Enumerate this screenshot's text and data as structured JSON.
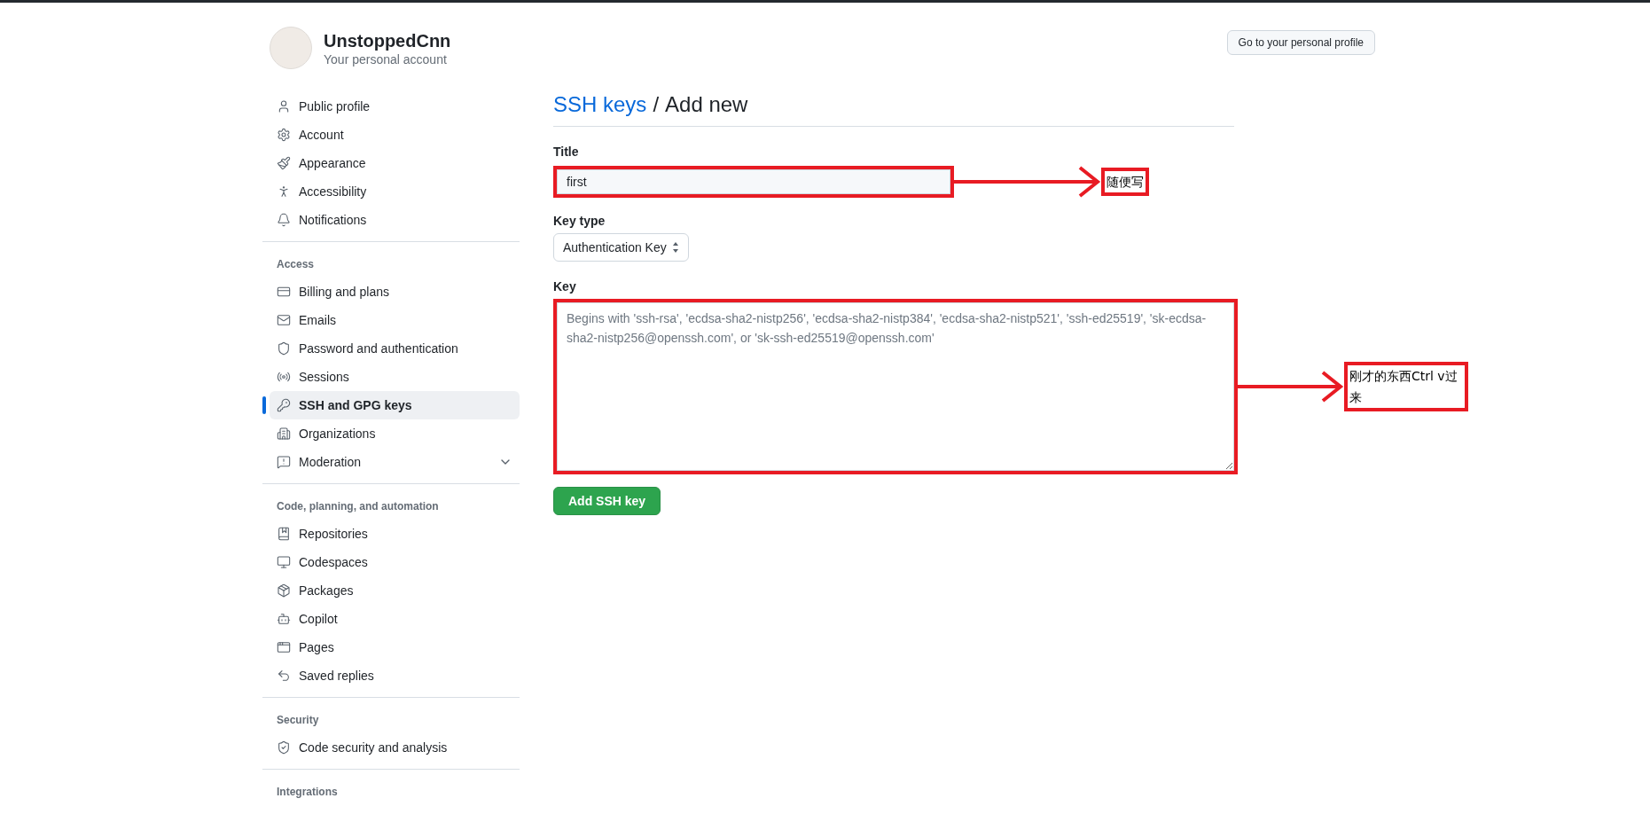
{
  "account": {
    "name": "UnstoppedCnn",
    "subtitle": "Your personal account"
  },
  "profile_button": "Go to your personal profile",
  "sidebar": {
    "sections": [
      {
        "items": [
          {
            "label": "Public profile",
            "selected": false
          },
          {
            "label": "Account",
            "selected": false
          },
          {
            "label": "Appearance",
            "selected": false
          },
          {
            "label": "Accessibility",
            "selected": false
          },
          {
            "label": "Notifications",
            "selected": false
          }
        ]
      },
      {
        "heading": "Access",
        "items": [
          {
            "label": "Billing and plans",
            "selected": false
          },
          {
            "label": "Emails",
            "selected": false
          },
          {
            "label": "Password and authentication",
            "selected": false
          },
          {
            "label": "Sessions",
            "selected": false
          },
          {
            "label": "SSH and GPG keys",
            "selected": true
          },
          {
            "label": "Organizations",
            "selected": false
          },
          {
            "label": "Moderation",
            "selected": false,
            "expanded": false
          }
        ]
      },
      {
        "heading": "Code, planning, and automation",
        "items": [
          {
            "label": "Repositories",
            "selected": false
          },
          {
            "label": "Codespaces",
            "selected": false
          },
          {
            "label": "Packages",
            "selected": false
          },
          {
            "label": "Copilot",
            "selected": false
          },
          {
            "label": "Pages",
            "selected": false
          },
          {
            "label": "Saved replies",
            "selected": false
          }
        ]
      },
      {
        "heading": "Security",
        "items": [
          {
            "label": "Code security and analysis",
            "selected": false
          }
        ]
      },
      {
        "heading": "Integrations"
      }
    ]
  },
  "breadcrumb": {
    "link": "SSH keys",
    "separator": "/",
    "current": "Add new"
  },
  "form": {
    "title_label": "Title",
    "title_value": "first",
    "key_type_label": "Key type",
    "key_type_value": "Authentication Key",
    "key_label": "Key",
    "key_placeholder": "Begins with 'ssh-rsa', 'ecdsa-sha2-nistp256', 'ecdsa-sha2-nistp384', 'ecdsa-sha2-nistp521', 'ssh-ed25519', 'sk-ecdsa-sha2-nistp256@openssh.com', or 'sk-ssh-ed25519@openssh.com'",
    "submit": "Add SSH key"
  },
  "annotations": [
    {
      "text": "随便写"
    },
    {
      "text": "刚才的东西Ctrl v过来"
    }
  ]
}
